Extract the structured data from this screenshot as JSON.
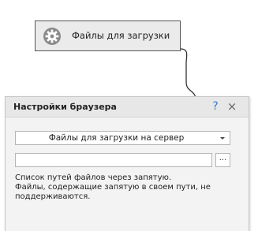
{
  "node": {
    "icon": "gear-icon",
    "label": "Файлы для загрузки"
  },
  "panel": {
    "title": "Настройки браузера",
    "help_label": "?",
    "close_label": "×",
    "select": {
      "value": "Файлы для загрузки на сервер"
    },
    "path_input": {
      "value": "",
      "placeholder": ""
    },
    "browse_label": "...",
    "hint_lines": [
      "Список путей файлов через запятую.",
      "Файлы, содержащие запятую в своем пути, не",
      "поддерживаются."
    ]
  },
  "colors": {
    "node_bg": "#ebebeb",
    "node_border": "#555555",
    "panel_bg": "#f3f3f3",
    "help_accent": "#2f7fd6"
  }
}
